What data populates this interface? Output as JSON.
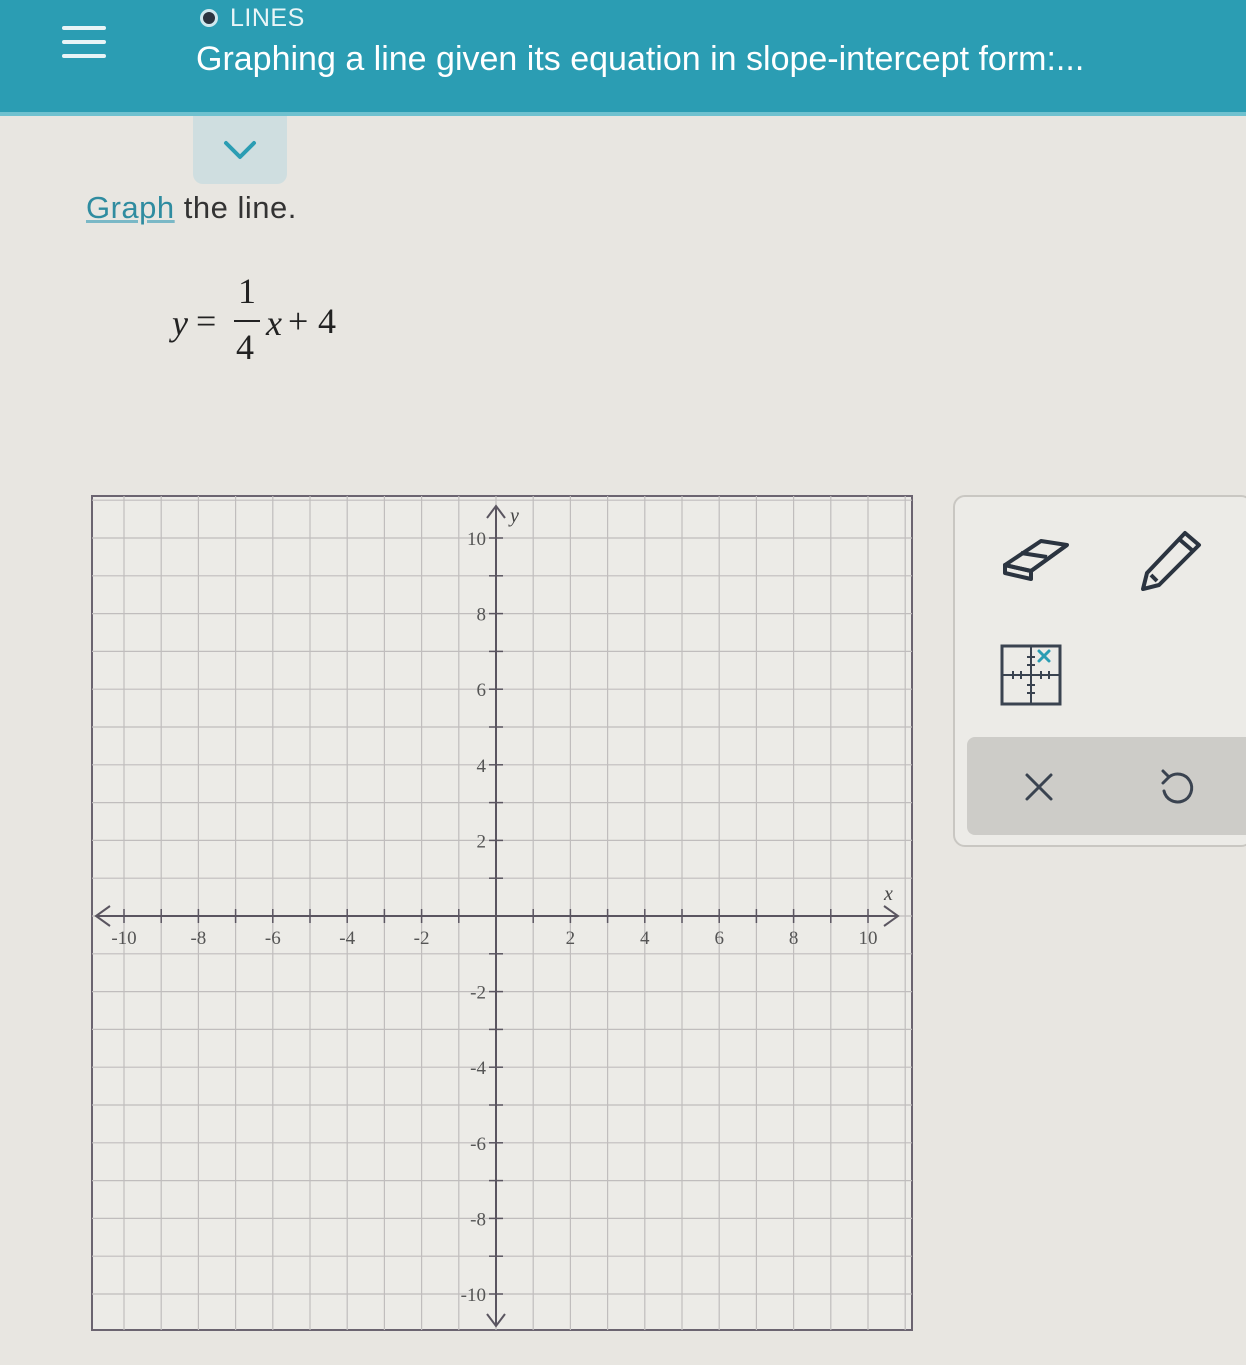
{
  "header": {
    "topic_label": "LINES",
    "title": "Graphing a line given its equation in slope-intercept form:...",
    "background_color": "#2b9db3"
  },
  "prompt": {
    "link_text": "Graph",
    "rest_text": " the line."
  },
  "equation": {
    "lhs": "y",
    "equals": "=",
    "numerator": "1",
    "denominator": "4",
    "variable": "x",
    "plus": "+",
    "constant": "4"
  },
  "graph": {
    "x_axis_label": "x",
    "y_axis_label": "y",
    "x_range": [
      -10,
      10
    ],
    "y_range": [
      -10,
      10
    ],
    "x_tick_labels": [
      "-10",
      "-8",
      "-6",
      "-4",
      "-2",
      "2",
      "4",
      "6",
      "8",
      "10"
    ],
    "y_tick_labels": [
      "10",
      "8",
      "6",
      "4",
      "2",
      "-2",
      "-4",
      "-6",
      "-8",
      "-10"
    ],
    "grid_step": 1,
    "line_color": "#c0bdbd",
    "axis_color": "#5a5560"
  },
  "tools": {
    "icons": [
      "eraser-icon",
      "pencil-icon",
      "point-grid-icon",
      "clear-icon",
      "undo-icon"
    ],
    "clear_glyph": "✕"
  }
}
